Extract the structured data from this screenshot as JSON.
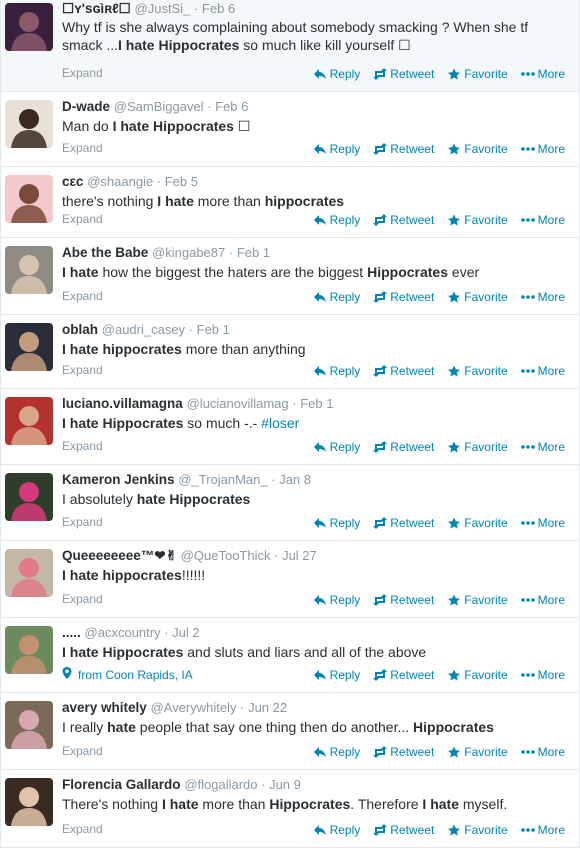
{
  "actions": {
    "reply": "Reply",
    "retweet": "Retweet",
    "favorite": "Favorite",
    "more": "More"
  },
  "expand_label": "Expand",
  "tweets": [
    {
      "name": "☐ʏ'ѕɢìʀℓ☐",
      "handle": "@JustSi_",
      "date": "Feb 6",
      "lines": [
        [
          {
            "t": "Why tf is she always complaining about somebody smacking ? When she tf"
          }
        ],
        [
          {
            "t": "smack ..."
          },
          {
            "b": "I hate Hippocrates"
          },
          {
            "t": " so much like kill yourself ☐"
          }
        ]
      ],
      "avatar_colors": [
        "#3b1f3f",
        "#8a5a6a"
      ]
    },
    {
      "name": "D-wade",
      "handle": "@SamBiggavel",
      "date": "Feb 6",
      "lines": [
        [
          {
            "t": "Man do "
          },
          {
            "b": "I hate Hippocrates"
          },
          {
            "t": " ☐"
          }
        ]
      ],
      "avatar_colors": [
        "#e8e2d6",
        "#3a2a1e"
      ]
    },
    {
      "name": "ϲεϲ",
      "handle": "@shaangie",
      "date": "Feb 5",
      "lines": [
        [
          {
            "t": "there's nothing "
          },
          {
            "b": "I hate"
          },
          {
            "t": " more than "
          },
          {
            "b": "hippocrates"
          }
        ]
      ],
      "avatar_colors": [
        "#f3c9cf",
        "#7a4a3a"
      ]
    },
    {
      "name": "Abe the Babe",
      "handle": "@kingabe87",
      "date": "Feb 1",
      "lines": [
        [
          {
            "b": "I hate"
          },
          {
            "t": " how the biggest the haters are the biggest "
          },
          {
            "b": "Hippocrates"
          },
          {
            "t": " ever"
          }
        ]
      ],
      "avatar_colors": [
        "#8f8a84",
        "#d7c4ae"
      ]
    },
    {
      "name": "oblah",
      "handle": "@audri_casey",
      "date": "Feb 1",
      "lines": [
        [
          {
            "b": "I hate hippocrates"
          },
          {
            "t": " more than anything"
          }
        ]
      ],
      "avatar_colors": [
        "#2a2d3a",
        "#c49b7d"
      ]
    },
    {
      "name": "luciano.villamagna",
      "handle": "@lucianovillamag",
      "date": "Feb 1",
      "lines": [
        [
          {
            "b": "I hate Hippocrates"
          },
          {
            "t": " so much -.- "
          },
          {
            "l": "#loser"
          }
        ]
      ],
      "avatar_colors": [
        "#b3322e",
        "#d9a48a"
      ]
    },
    {
      "name": "Kameron Jenkins",
      "handle": "@_TrojanMan_",
      "date": "Jan 8",
      "lines": [
        [
          {
            "t": "I absolutely "
          },
          {
            "b": "hate"
          },
          {
            "t": "  "
          },
          {
            "b": "Hippocrates"
          }
        ]
      ],
      "avatar_colors": [
        "#2f3d2a",
        "#d63a7c"
      ]
    },
    {
      "name": "Queeeeeeee™❤︎✌︎",
      "handle": "@QueTooThick",
      "date": "Jul 27",
      "lines": [
        [
          {
            "b": "I hate hippocrates"
          },
          {
            "t": "!!!!!!"
          }
        ]
      ],
      "avatar_colors": [
        "#c4b7a6",
        "#e07b8a"
      ]
    },
    {
      "name": ".....",
      "handle": "@acxcountry",
      "date": "Jul 2",
      "lines": [
        [
          {
            "b": "I hate Hippocrates"
          },
          {
            "t": " and sluts and liars and all of the above"
          }
        ]
      ],
      "location": "from Coon Rapids, IA",
      "avatar_colors": [
        "#6b8a5e",
        "#c39170"
      ]
    },
    {
      "name": "avery whitely",
      "handle": "@Averywhitely",
      "date": "Jun 22",
      "lines": [
        [
          {
            "t": "I really "
          },
          {
            "b": "hate"
          },
          {
            "t": " people that say one thing then do another... "
          },
          {
            "b": "Hippocrates"
          }
        ]
      ],
      "avatar_colors": [
        "#7b6a5a",
        "#d9a7b0"
      ]
    },
    {
      "name": "Florencia Gallardo",
      "handle": "@flogallardo",
      "date": "Jun 9",
      "lines": [
        [
          {
            "t": "There's nothing "
          },
          {
            "b": "I hate"
          },
          {
            "t": " more than "
          },
          {
            "b": "Hippocrates"
          },
          {
            "t": ". Therefore "
          },
          {
            "b": "I hate"
          },
          {
            "t": " myself."
          }
        ]
      ],
      "avatar_colors": [
        "#3a2a22",
        "#e2c2a8"
      ]
    }
  ]
}
